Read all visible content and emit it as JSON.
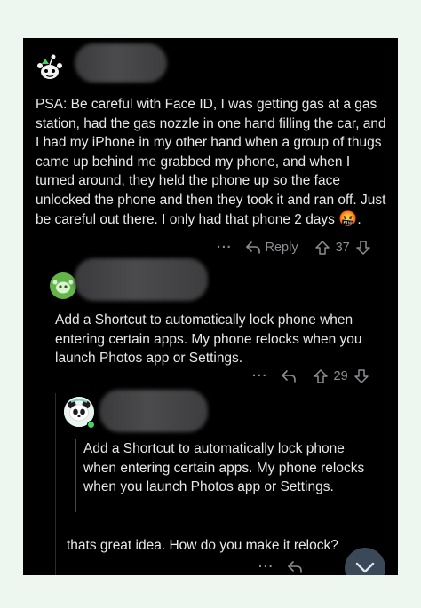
{
  "comments": [
    {
      "avatar_icon": "snoo-avatar",
      "text": "PSA:  Be careful with Face ID, I was getting gas at a gas station, had the gas nozzle in one hand filling the car, and I had my iPhone in my other hand when a group of thugs came up behind me grabbed my phone, and when I turned around, they held the phone up so the face unlocked the phone and then they took it and ran off. Just be careful out there.  I only had that phone 2 days",
      "emoji": "🤬",
      "suffix": ".",
      "more": "···",
      "reply_label": "Reply",
      "votes": "37"
    },
    {
      "avatar_icon": "snoo-avatar",
      "text": "Add a Shortcut to automatically lock phone when entering certain apps. My phone relocks when you launch Photos app or Settings.",
      "more": "···",
      "votes": "29"
    },
    {
      "avatar_icon": "panda-avatar",
      "quote": "Add a Shortcut to automatically lock phone when entering certain apps. My phone relocks when you launch Photos app or Settings.",
      "text": "thats great idea. How do you make it relock?",
      "more": "···"
    }
  ],
  "colors": {
    "background": "#000000",
    "text": "#e8e8ea",
    "meta": "#8e8e93",
    "online": "#46d160"
  }
}
